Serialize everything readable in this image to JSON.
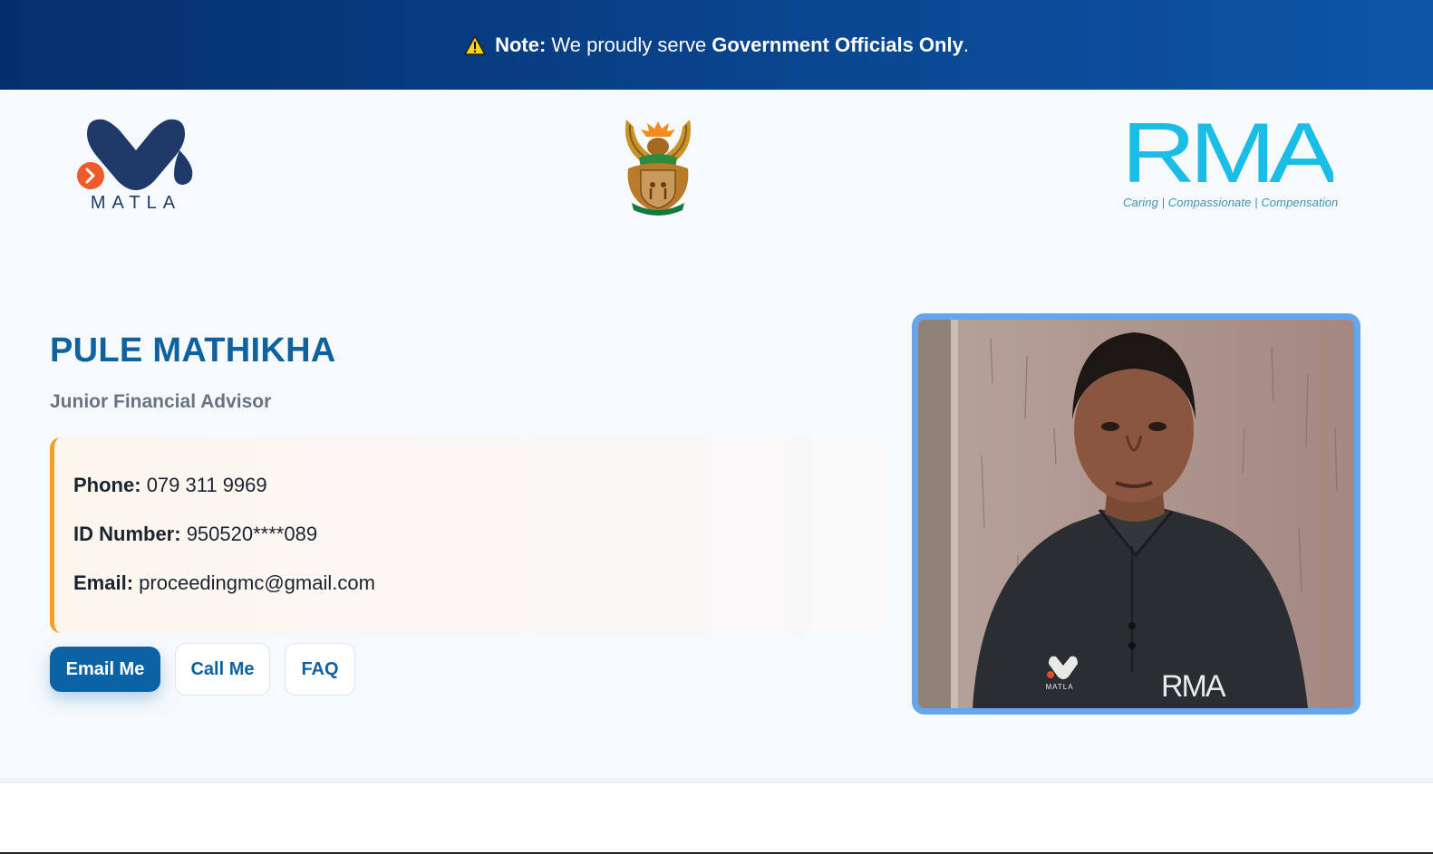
{
  "banner": {
    "note_label": "Note:",
    "text": " We proudly serve ",
    "highlight": "Government Officials Only",
    "end": "."
  },
  "logos": {
    "matla_text": "MATLA",
    "rma_text": "RMA",
    "rma_tagline": "Caring | Compassionate | Compensation",
    "photo_shirt_rma": "RMA",
    "photo_shirt_matla": "MATLA"
  },
  "profile": {
    "name": "PULE MATHIKHA",
    "role": "Junior Financial Advisor",
    "phone_label": "Phone:",
    "phone": "079 311 9969",
    "id_label": "ID Number:",
    "id": "950520****089",
    "email_label": "Email:",
    "email": "proceedingmc@gmail.com"
  },
  "actions": {
    "email": "Email Me",
    "call": "Call Me",
    "faq": "FAQ"
  },
  "colors": {
    "banner": "#0a4792",
    "accent_blue": "#0e62a0",
    "card_border": "#f5a020",
    "photo_border": "#64a6ea",
    "rma_cyan": "#1bbde6"
  },
  "icons": {
    "warning": "warning-icon",
    "matla": "matla-logo",
    "coat": "coat-of-arms-icon",
    "rma": "rma-logo"
  }
}
